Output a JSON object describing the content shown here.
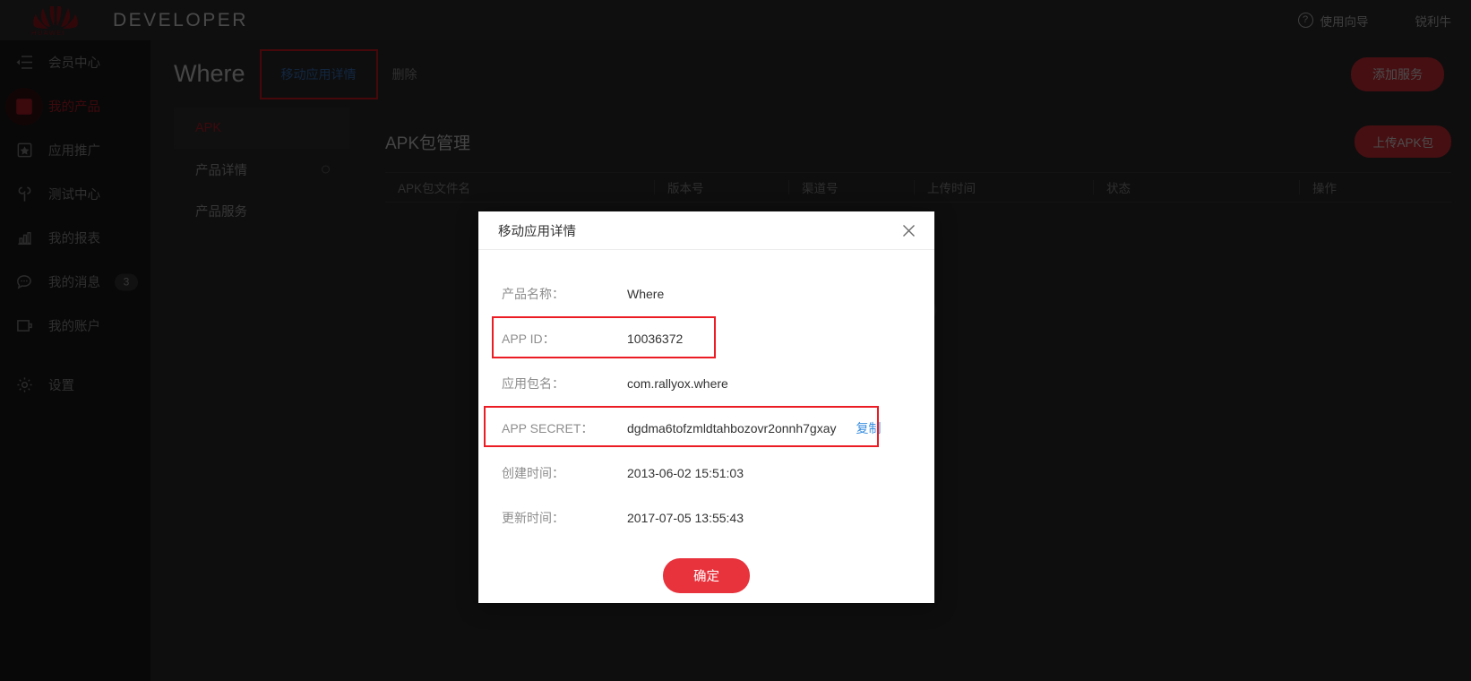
{
  "topbar": {
    "brand": "DEVELOPER",
    "logo_text": "HUAWEI",
    "guide_label": "使用向导",
    "guide_icon": "question-circle-icon",
    "user_name": "锐利牛"
  },
  "sidebar": {
    "items": [
      {
        "label": "会员中心",
        "icon": "member-center-icon",
        "active": false,
        "badge": ""
      },
      {
        "label": "我的产品",
        "icon": "bookmark-icon",
        "active": true,
        "badge": ""
      },
      {
        "label": "应用推广",
        "icon": "star-badge-icon",
        "active": false,
        "badge": ""
      },
      {
        "label": "测试中心",
        "icon": "wrench-icon",
        "active": false,
        "badge": ""
      },
      {
        "label": "我的报表",
        "icon": "bar-chart-icon",
        "active": false,
        "badge": ""
      },
      {
        "label": "我的消息",
        "icon": "chat-bubble-icon",
        "active": false,
        "badge": "3"
      },
      {
        "label": "我的账户",
        "icon": "wallet-icon",
        "active": false,
        "badge": ""
      },
      {
        "label": "设置",
        "icon": "gear-icon",
        "active": false,
        "badge": ""
      }
    ]
  },
  "page": {
    "title": "Where",
    "detail_link": "移动应用详情",
    "delete_link": "删除",
    "add_service_button": "添加服务"
  },
  "subnav": {
    "items": [
      {
        "label": "APK",
        "active": true,
        "dot": false
      },
      {
        "label": "产品详情",
        "active": false,
        "dot": true
      },
      {
        "label": "产品服务",
        "active": false,
        "dot": false
      }
    ]
  },
  "apk_panel": {
    "title": "APK包管理",
    "upload_button": "上传APK包",
    "columns": [
      "APK包文件名",
      "版本号",
      "渠道号",
      "上传时间",
      "状态",
      "操作"
    ]
  },
  "modal": {
    "title": "移动应用详情",
    "close_icon": "close-icon",
    "fields": [
      {
        "label": "产品名称：",
        "value": "Where",
        "highlight": false,
        "copy": ""
      },
      {
        "label": "APP ID：",
        "value": "10036372",
        "highlight": true,
        "copy": ""
      },
      {
        "label": "应用包名：",
        "value": "com.rallyox.where",
        "highlight": false,
        "copy": ""
      },
      {
        "label": "APP SECRET：",
        "value": "dgdma6tofzmldtahbozovr2onnh7gxay",
        "highlight": true,
        "copy": "复制"
      },
      {
        "label": "创建时间：",
        "value": "2013-06-02 15:51:03",
        "highlight": false,
        "copy": ""
      },
      {
        "label": "更新时间：",
        "value": "2017-07-05 13:55:43",
        "highlight": false,
        "copy": ""
      }
    ],
    "confirm_button": "确定"
  },
  "colors": {
    "brand_red": "#e8323c",
    "highlight_red": "#ec1c24",
    "link_blue": "#3b8fe0",
    "active_red": "#c81d2b",
    "dark_bg": "#2e2e2e",
    "sidebar_bg": "#1c1c1c",
    "topbar_bg": "#333333"
  }
}
